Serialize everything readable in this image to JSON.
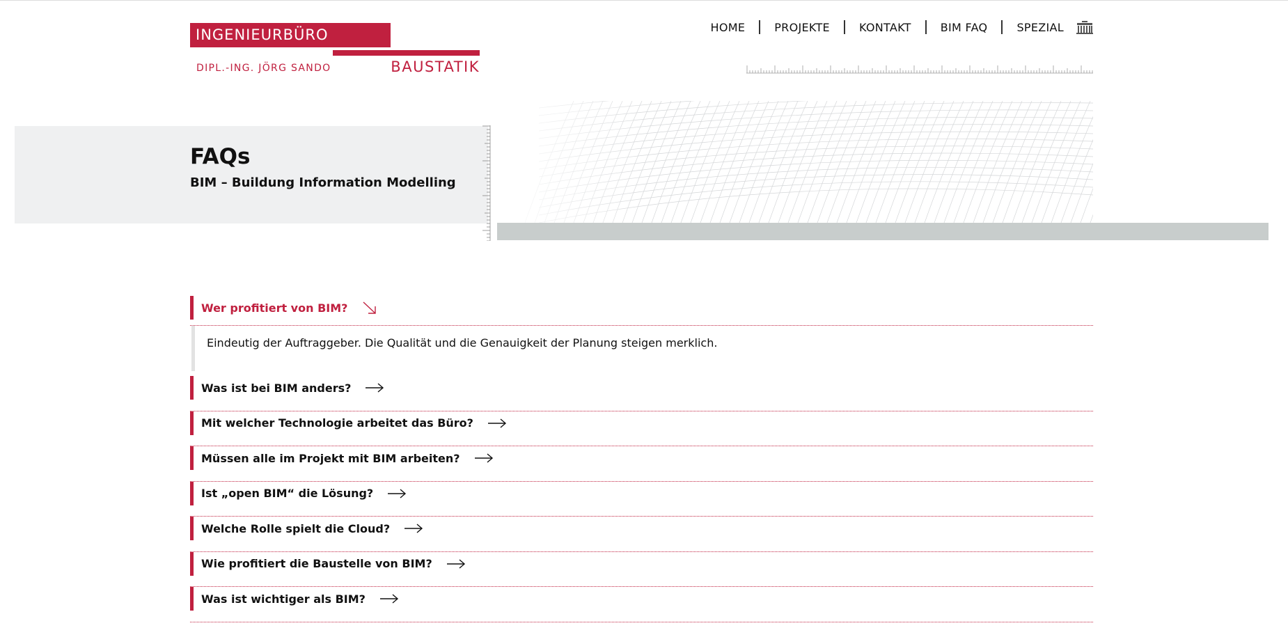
{
  "logo": {
    "box_text": "INGENIEURBÜRO",
    "sub_text": "DIPL.-ING. JÖRG SANDO",
    "main_text": "BAUSTATIK"
  },
  "nav": {
    "items": [
      "HOME",
      "PROJEKTE",
      "KONTAKT",
      "BIM FAQ",
      "SPEZIAL"
    ],
    "icon": "brandenburg-gate-icon"
  },
  "hero": {
    "title": "FAQs",
    "subtitle": "BIM – Buildung Information Modelling"
  },
  "faq": {
    "items": [
      {
        "question": "Wer profitiert von BIM?",
        "open": true,
        "answer": "Eindeutig der Auftraggeber. Die Qualität und die Genauigkeit der Planung steigen merklich."
      },
      {
        "question": "Was ist bei BIM anders?",
        "open": false
      },
      {
        "question": "Mit welcher Technologie arbeitet das Büro?",
        "open": false
      },
      {
        "question": "Müssen alle im Projekt mit BIM arbeiten?",
        "open": false
      },
      {
        "question": "Ist „open BIM“ die Lösung?",
        "open": false
      },
      {
        "question": "Welche Rolle spielt die Cloud?",
        "open": false
      },
      {
        "question": "Wie profitiert die Baustelle von BIM?",
        "open": false
      },
      {
        "question": "Was ist wichtiger als BIM?",
        "open": false
      }
    ]
  },
  "colors": {
    "accent": "#c0203f",
    "hero_grey": "#eff0f1",
    "band_grey": "#c8cdcc"
  }
}
